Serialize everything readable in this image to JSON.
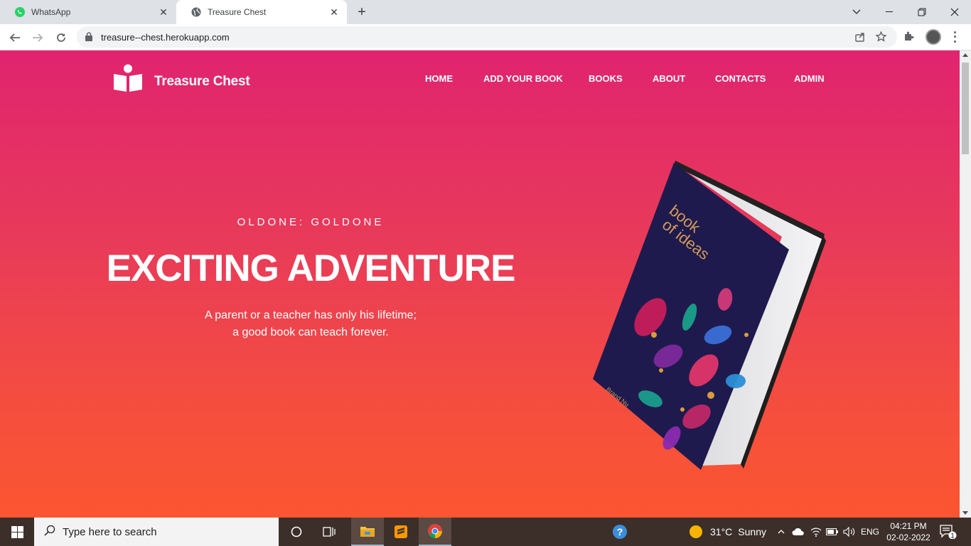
{
  "browser": {
    "tabs": [
      {
        "label": "WhatsApp"
      },
      {
        "label": "Treasure Chest"
      }
    ],
    "url": "treasure--chest.herokuapp.com"
  },
  "site": {
    "brand": "Treasure Chest",
    "nav": [
      "HOME",
      "ADD YOUR BOOK",
      "BOOKS",
      "ABOUT",
      "CONTACTS",
      "ADMIN"
    ],
    "hero": {
      "eyebrow": "OLDONE: GOLDONE",
      "headline": "EXCITING ADVENTURE",
      "tagline_line1": "A parent or a teacher has only his lifetime;",
      "tagline_line2": "a good book can teach forever."
    },
    "book_cover": {
      "title_line1": "book",
      "title_line2": "of ideas",
      "publisher": "Brand Nu"
    },
    "colors": {
      "gradient_top": "#e0246f",
      "gradient_bottom": "#fb5531",
      "book_cover": "#1f1a4d"
    }
  },
  "taskbar": {
    "search_placeholder": "Type here to search",
    "weather": {
      "temp": "31°C",
      "condition": "Sunny"
    },
    "language": "ENG",
    "time": "04:21 PM",
    "date": "02-02-2022",
    "notification_count": "1"
  }
}
